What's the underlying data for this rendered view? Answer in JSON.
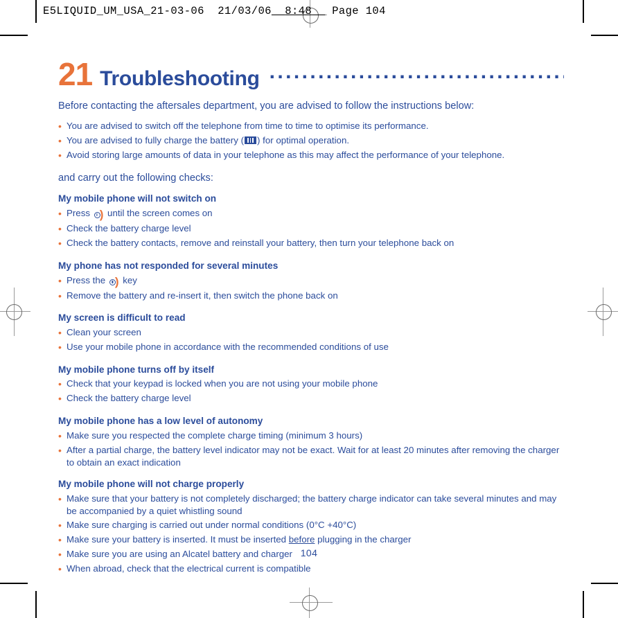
{
  "print_marks": {
    "crop_mark_color": "#000000",
    "registration_mark_color": "#9a9a9a"
  },
  "running_header": {
    "filename": "E5LIQUID_UM_USA_21-03-06",
    "date": "21/03/06",
    "time": "8:48",
    "page_label": "Page 104"
  },
  "chapter": {
    "number": "21",
    "name": "Troubleshooting",
    "leader_dots": "...........................................",
    "number_color": "#E8733A",
    "name_color": "#2B4C9B"
  },
  "intro": {
    "lead": "Before contacting the aftersales department, you are advised to follow the instructions below:",
    "bullets": [
      {
        "before": "You are advised to switch off the telephone from time to time to optimise its performance.",
        "icon": null,
        "after": ""
      },
      {
        "before": "You are advised to fully charge the battery (",
        "icon": "battery-icon",
        "after": ") for optimal operation."
      },
      {
        "before": "Avoid storing large amounts of data in your telephone as this may affect the performance of your telephone.",
        "icon": null,
        "after": ""
      }
    ],
    "checks_lead": "and carry out the following checks:"
  },
  "sections": [
    {
      "heading": "My mobile phone will not switch on",
      "bullets": [
        {
          "before": "Press ",
          "icon": "power-key-icon",
          "after": " until the screen comes on"
        },
        {
          "before": "Check the battery charge level",
          "icon": null,
          "after": ""
        },
        {
          "before": "Check the battery contacts, remove and reinstall your battery, then turn your telephone back on",
          "icon": null,
          "after": ""
        }
      ]
    },
    {
      "heading": "My phone has not responded for several minutes",
      "bullets": [
        {
          "before": "Press the ",
          "icon": "power-key-icon",
          "after": " key"
        },
        {
          "before": "Remove the battery and re-insert it, then switch the phone back on",
          "icon": null,
          "after": ""
        }
      ]
    },
    {
      "heading": "My screen is difficult to read",
      "bullets": [
        {
          "before": "Clean your screen",
          "icon": null,
          "after": ""
        },
        {
          "before": "Use your mobile phone in accordance with the recommended conditions of use",
          "icon": null,
          "after": ""
        }
      ]
    },
    {
      "heading": "My mobile phone turns off by itself",
      "bullets": [
        {
          "before": "Check that your keypad is locked when you are not using your mobile phone",
          "icon": null,
          "after": ""
        },
        {
          "before": "Check the battery charge level",
          "icon": null,
          "after": ""
        }
      ]
    },
    {
      "heading": "My mobile phone has a low level of autonomy",
      "bullets": [
        {
          "before": "Make sure you respected the complete charge timing (minimum 3 hours)",
          "icon": null,
          "after": ""
        },
        {
          "before": "After a partial charge, the battery level indicator may not be exact. Wait for at least 20 minutes after removing the charger to obtain an exact indication",
          "icon": null,
          "after": ""
        }
      ]
    },
    {
      "heading": "My mobile phone will not charge properly",
      "bullets": [
        {
          "before": "Make sure that your battery is not completely discharged; the battery charge indicator can take several minutes and may be accompanied by a quiet whistling sound",
          "icon": null,
          "after": ""
        },
        {
          "before": "Make sure charging is carried out under normal conditions (0°C +40°C)",
          "icon": null,
          "after": ""
        },
        {
          "before": "Make sure your battery is inserted. It must be inserted ",
          "icon": null,
          "underline": "before",
          "after": " plugging in the charger"
        },
        {
          "before": "Make sure you are using an Alcatel battery and charger",
          "icon": null,
          "after": ""
        },
        {
          "before": "When abroad, check that the electrical current is compatible",
          "icon": null,
          "after": ""
        }
      ]
    }
  ],
  "bullet_marker": "•",
  "page_number": "104"
}
